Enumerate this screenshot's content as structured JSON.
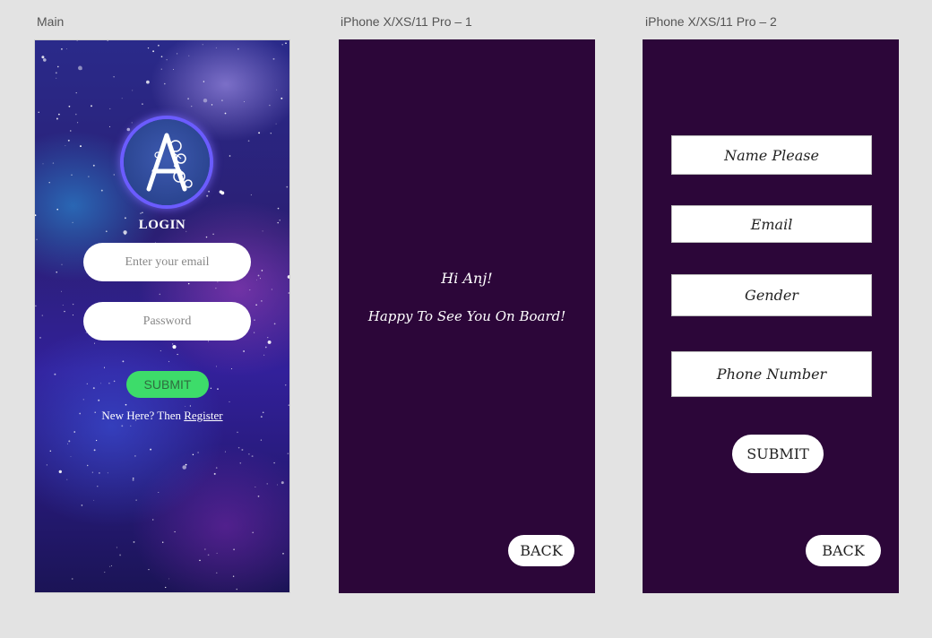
{
  "artboards": {
    "main_label": "Main",
    "screen1_label": "iPhone X/XS/11 Pro – 1",
    "screen2_label": "iPhone X/XS/11 Pro – 2"
  },
  "login": {
    "title": "LOGIN",
    "email_placeholder": "Enter your email",
    "password_placeholder": "Password",
    "submit_label": "SUBMIT",
    "register_prefix": "New Here? Then ",
    "register_link": "Register"
  },
  "welcome": {
    "greeting": "Hi Anj!",
    "message": "Happy To See You On Board!",
    "back_label": "BACK"
  },
  "register": {
    "name_placeholder": "Name Please",
    "email_placeholder": "Email",
    "gender_placeholder": "Gender",
    "phone_placeholder": "Phone Number",
    "submit_label": "SUBMIT",
    "back_label": "BACK"
  },
  "colors": {
    "canvas": "#e3e3e3",
    "screen_purple": "#2c0639",
    "submit_green": "#3ddc6a",
    "logo_ring": "#6b5cff"
  }
}
